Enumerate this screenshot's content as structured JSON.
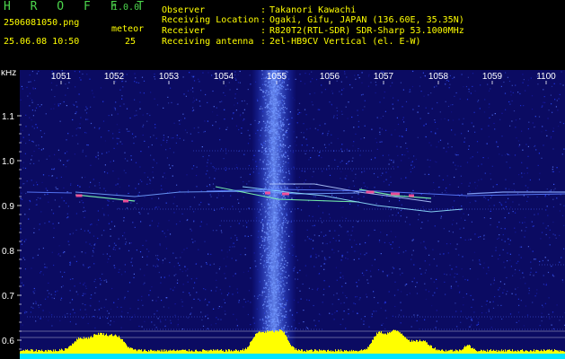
{
  "app": {
    "title_letters": "H R O F F T",
    "version": "1.0.0"
  },
  "file": {
    "name": "2506081050.png",
    "datetime": "25.06.08 10:50"
  },
  "counter": {
    "label": "meteor",
    "value": "25"
  },
  "info": [
    {
      "label": "Observer",
      "value": "Takanori Kawachi"
    },
    {
      "label": "Receiving Location",
      "value": "Ogaki, Gifu, JAPAN (136.60E, 35.35N)"
    },
    {
      "label": "Receiver",
      "value": "R820T2(RTL-SDR) SDR-Sharp 53.1000MHz"
    },
    {
      "label": "Receiving antenna",
      "value": "2el-HB9CV Vertical (el. E-W)"
    }
  ],
  "axis": {
    "y_unit": "kHz",
    "x_ticks": [
      "1051",
      "1052",
      "1053",
      "1054",
      "1055",
      "1056",
      "1057",
      "1058",
      "1059",
      "1100"
    ],
    "y_ticks": [
      "1.1",
      "1.0",
      "0.9",
      "0.8",
      "0.7",
      "0.6"
    ]
  },
  "colors": {
    "background": "#000000",
    "plot_bg": "#0a0a6e",
    "noise": "#2b4fff",
    "signal": "#ff5a9a",
    "trail": "#88ffcc",
    "spectrum_fill": "#ffff00",
    "grid_line": "#ffffff"
  }
}
